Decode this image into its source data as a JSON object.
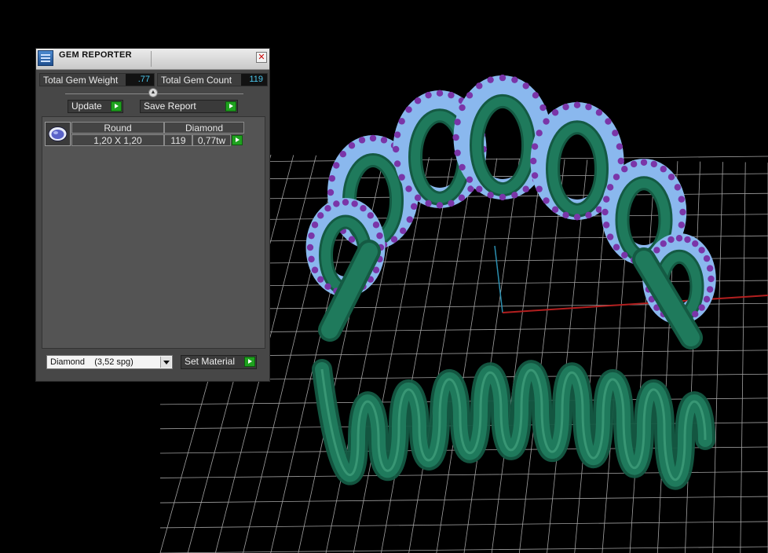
{
  "window": {
    "title": "GEM REPORTER",
    "close_icon": "close-icon",
    "app_icon": "gem-reporter-icon"
  },
  "summary": {
    "weight_label": "Total Gem Weight",
    "weight_value": ".77",
    "count_label": "Total Gem Count",
    "count_value": "119"
  },
  "buttons": {
    "update": "Update",
    "save_report": "Save Report",
    "set_material": "Set Material"
  },
  "gem_list": [
    {
      "shape": "Round",
      "material": "Diamond",
      "size": "1,20 X 1,20",
      "count": "119",
      "weight": "0,77tw"
    }
  ],
  "material_select": {
    "value": "Diamond    (3,52 spg)"
  },
  "colors": {
    "panel_bg": "#474747",
    "value_text": "#4cc8ee",
    "go_button": "#1fa21f",
    "ring_metal": "#1f7a5c",
    "gem_setting": "#8ab8ee",
    "gem_stone": "#7a35a8",
    "grid_line": "#bfbfbf",
    "axis_x": "#b21f1f",
    "axis_y": "#2b8fb0"
  }
}
